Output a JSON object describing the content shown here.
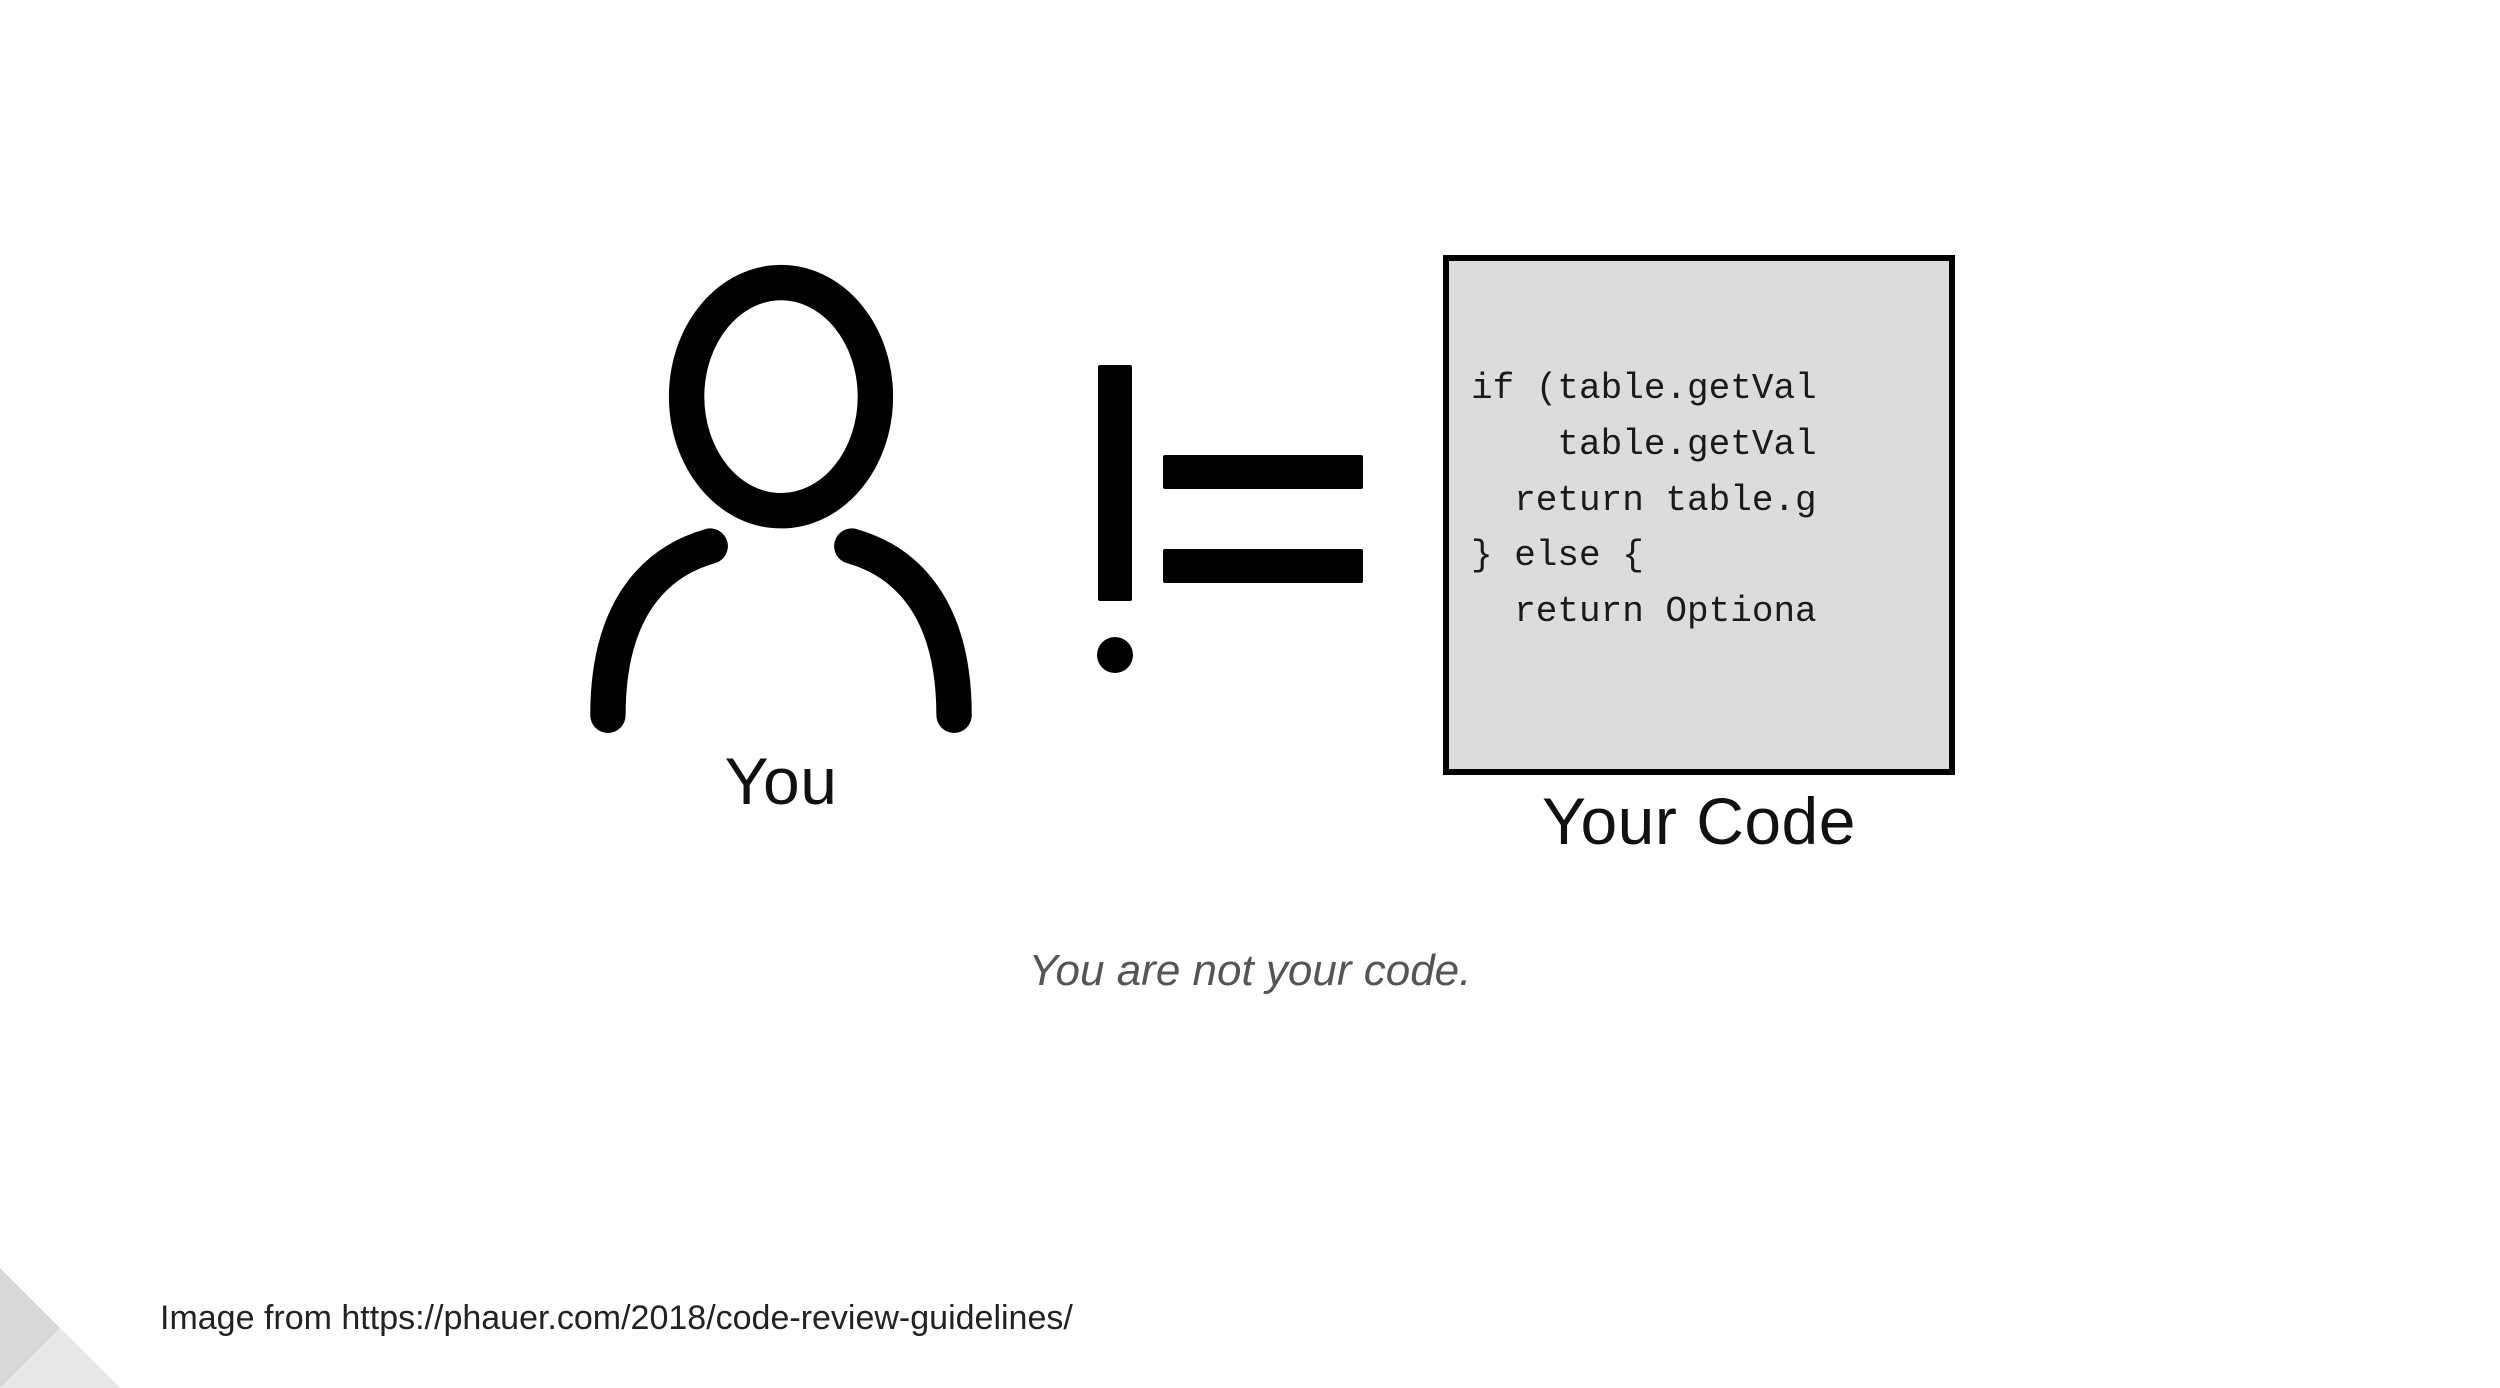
{
  "figure": {
    "you_label": "You",
    "code_label": "Your Code",
    "code_lines": [
      "if (table.getVal",
      "    table.getVal",
      "  return table.g",
      "} else {",
      "  return Optiona"
    ]
  },
  "caption": "You are not your code.",
  "footer_text": "Image from https://phauer.com/2018/code-review-guidelines/"
}
